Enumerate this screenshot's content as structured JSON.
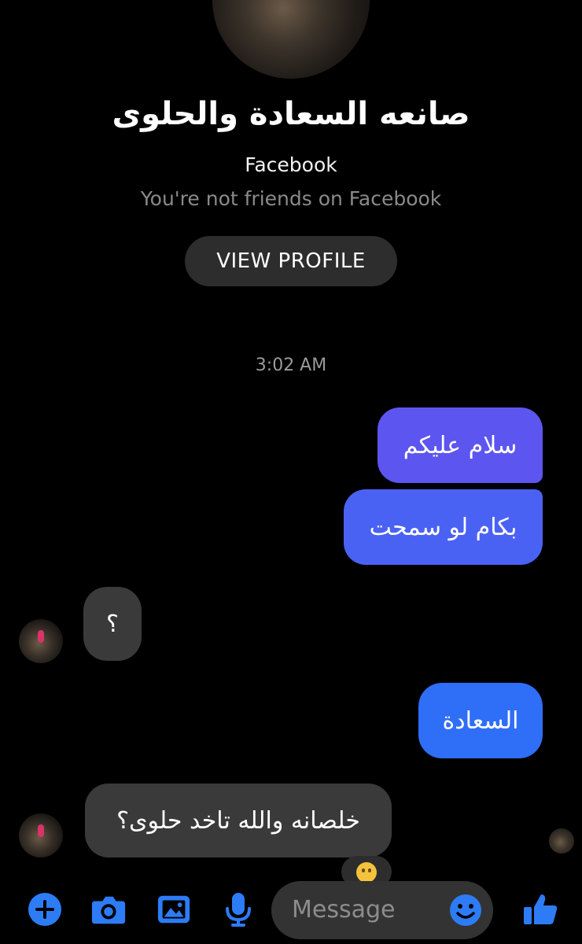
{
  "header": {
    "name": "صانعه السعادة والحلوى",
    "platform": "Facebook",
    "friend_status": "You're not friends on Facebook",
    "view_profile_label": "VIEW PROFILE"
  },
  "thread": {
    "timestamp": "3:02 AM",
    "messages": [
      {
        "from": "me",
        "text": "سلام عليكم"
      },
      {
        "from": "me",
        "text": "بكام لو سمحت"
      },
      {
        "from": "them",
        "text": "؟"
      },
      {
        "from": "me",
        "text": "السعادة"
      },
      {
        "from": "them",
        "text": "خلصانه والله تاخد حلوى؟",
        "reaction": "hushed-face-emoji"
      }
    ]
  },
  "composer": {
    "placeholder": "Message",
    "actions": [
      "plus-icon",
      "camera-icon",
      "gallery-icon",
      "microphone-icon",
      "emoji-icon",
      "like-icon"
    ]
  },
  "colors": {
    "background": "#000000",
    "accent": "#2f6ef7",
    "received_bubble": "#3a3a3a",
    "sent_top": "#5d55ef"
  }
}
